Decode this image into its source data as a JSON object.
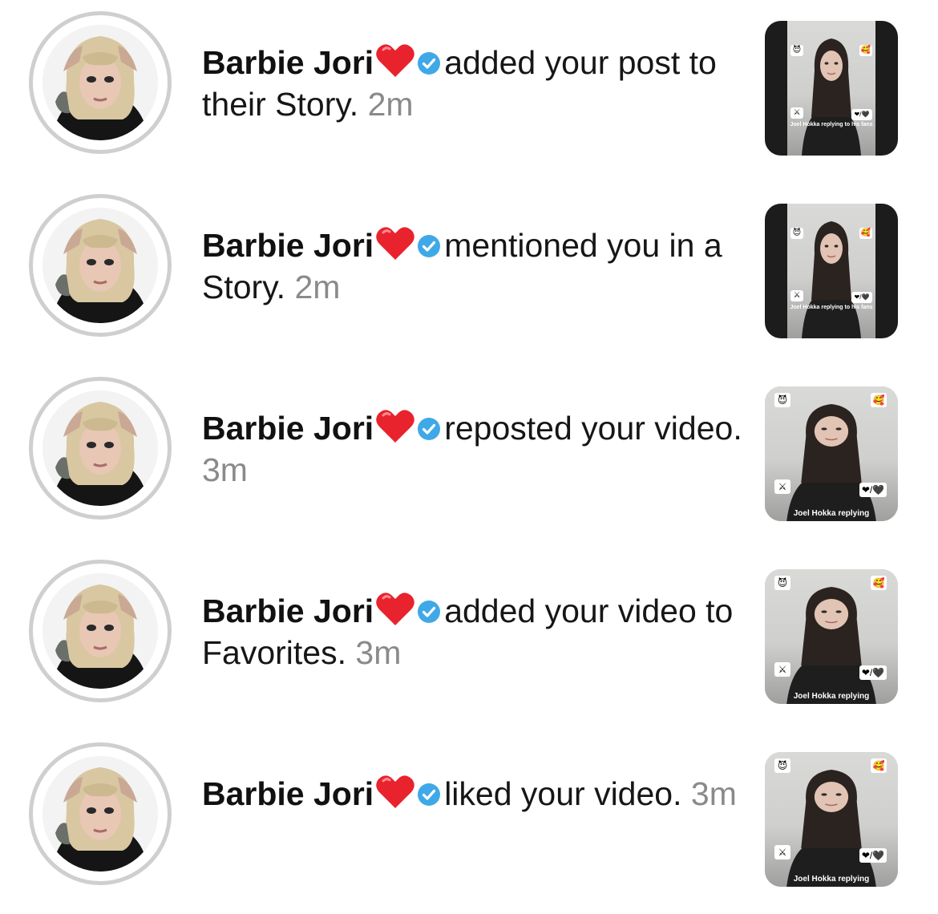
{
  "notifications": [
    {
      "user": "Barbie Jori",
      "action": "added your post to their Story.",
      "time": "2m",
      "thumb_style": "dark",
      "caption": "Joel Hokka replying to his fans"
    },
    {
      "user": "Barbie Jori",
      "action": "mentioned you in a Story.",
      "time": "2m",
      "thumb_style": "dark",
      "caption": "Joel Hokka replying to his fans"
    },
    {
      "user": "Barbie Jori",
      "action": "reposted your video.",
      "time": "3m",
      "thumb_style": "light",
      "caption": "Joel Hokka replying"
    },
    {
      "user": "Barbie Jori",
      "action": "added your video to Favorites.",
      "time": "3m",
      "thumb_style": "light",
      "caption": "Joel Hokka replying"
    },
    {
      "user": "Barbie Jori",
      "action": "liked your video.",
      "time": "3m",
      "thumb_style": "light",
      "caption": "Joel Hokka replying"
    }
  ],
  "icons": {
    "heart": "red-heart-icon",
    "verified": "verified-badge-icon"
  },
  "colors": {
    "verified_blue": "#3fa9e8",
    "heart_red": "#e8232e",
    "timestamp_gray": "#8a8a8a"
  }
}
